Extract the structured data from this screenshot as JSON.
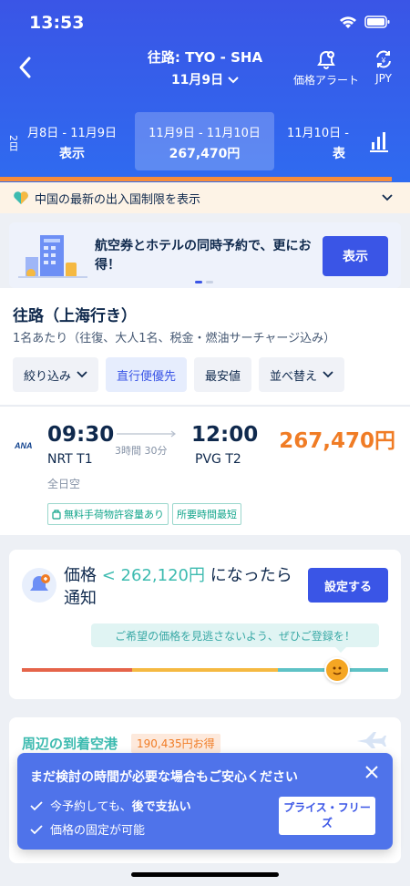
{
  "status": {
    "time": "13:53"
  },
  "header": {
    "route": "往路: TYO - SHA",
    "date": "11月9日",
    "price_alert_label": "価格アラート",
    "currency": "JPY"
  },
  "date_tabs": [
    {
      "range": "月8日 - 11月9日",
      "price": "表示"
    },
    {
      "range": "11月9日 - 11月10日",
      "price": "267,470円"
    },
    {
      "range": "11月10日 - ",
      "price": "表"
    }
  ],
  "side_label": "2日",
  "notice": {
    "text": "中国の最新の出入国制限を表示"
  },
  "banner": {
    "text": "航空券とホテルの同時予約で、更にお得！",
    "button": "表示"
  },
  "section": {
    "title": "往路（上海行き）",
    "subtitle": "1名あたり（往復、大人1名、税金・燃油サーチャージ込み）",
    "filters": [
      "絞り込み",
      "直行便優先",
      "最安値",
      "並べ替え"
    ]
  },
  "flight": {
    "airline_code": "ANA",
    "dep_time": "09:30",
    "dep_airport": "NRT T1",
    "duration": "3時間 30分",
    "arr_time": "12:00",
    "arr_airport": "PVG T2",
    "price": "267,470円",
    "airline": "全日空",
    "tags": [
      "無料手荷物許容量あり",
      "所要時間最短"
    ]
  },
  "price_alert": {
    "prefix": "価格",
    "value": "< 262,120円",
    "suffix": "になったら通知",
    "button": "設定する",
    "hint": "ご希望の価格を見逃さないよう、ぜひご登録を！",
    "knob_position": 0.86
  },
  "nearby": {
    "title": "周辺の到着空港",
    "badge": "190,435円お得"
  },
  "toast": {
    "title": "まだ検討の時間が必要な場合もご安心ください",
    "line1_pre": "今予約しても、",
    "line1_bold": "後で支払い",
    "line2": "価格の固定が可能",
    "button": "プライス・フリーズ"
  },
  "colors": {
    "primary": "#3a55e6",
    "price": "#f07c25",
    "teal": "#3dbbb0"
  }
}
